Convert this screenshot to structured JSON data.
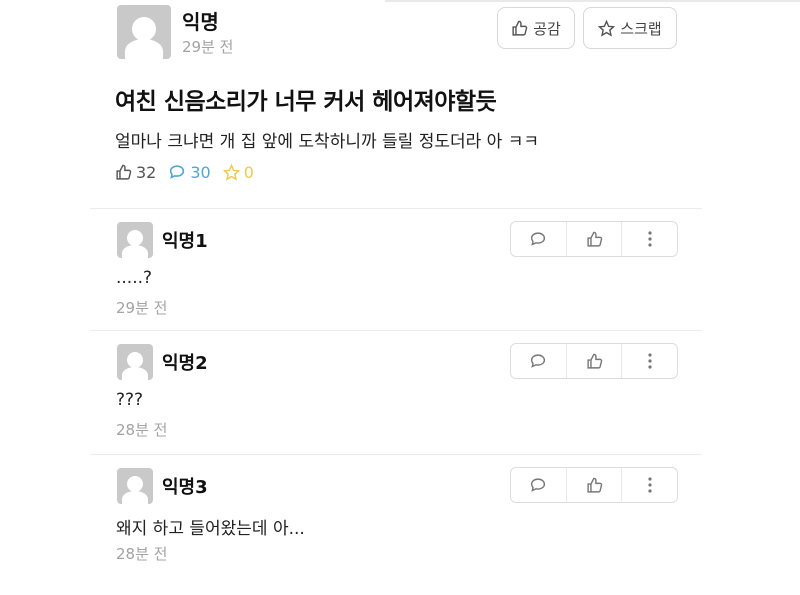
{
  "post": {
    "author": "익명",
    "time": "29분 전",
    "title": "여친 신음소리가 너무 커서 헤어져야할듯",
    "body": "얼마나 크냐면 개 집 앞에 도착하니까 들릴 정도더라 아 ㅋㅋ",
    "like_count": "32",
    "comment_count": "30",
    "scrap_count": "0",
    "like_button": "공감",
    "scrap_button": "스크랩"
  },
  "comments": [
    {
      "author": "익명1",
      "text": ".....?",
      "time": "29분 전"
    },
    {
      "author": "익명2",
      "text": "???",
      "time": "28분 전"
    },
    {
      "author": "익명3",
      "text": "왜지 하고 들어왔는데 아...",
      "time": "28분 전"
    }
  ],
  "colors": {
    "like": "#555555",
    "comment": "#4aa7d6",
    "scrap": "#f2c84b"
  }
}
